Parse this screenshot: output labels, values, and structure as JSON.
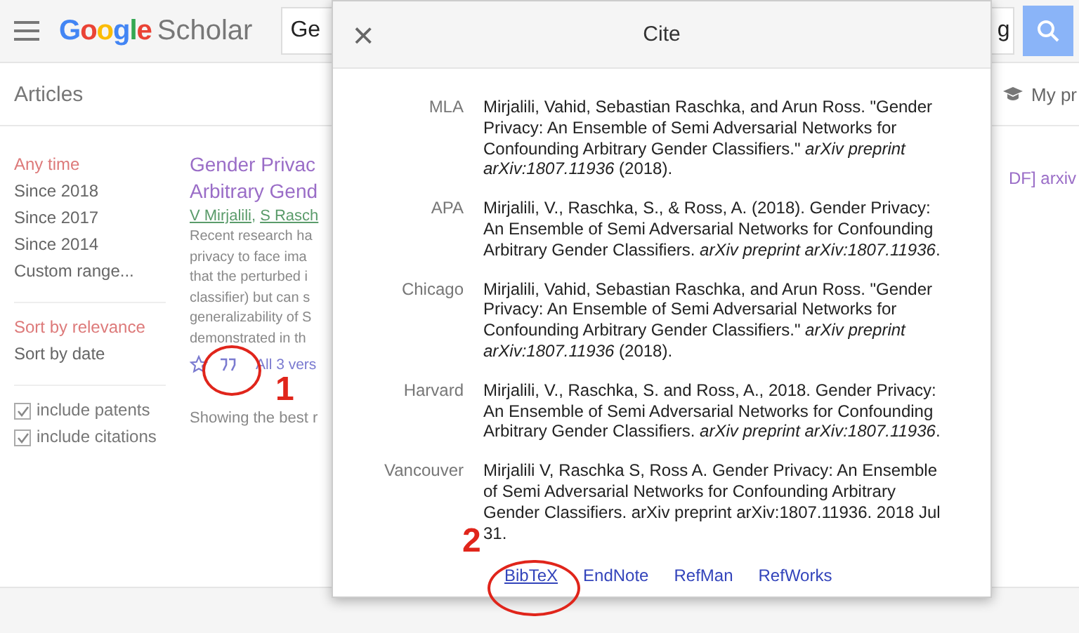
{
  "header": {
    "logo_colored": "Google",
    "logo_rest": "Scholar",
    "search_value_left": "Ge",
    "search_value_right": "g"
  },
  "subbar": {
    "title": "Articles",
    "right": "My pr"
  },
  "filters": {
    "time": [
      {
        "label": "Any time",
        "selected": true
      },
      {
        "label": "Since 2018",
        "selected": false
      },
      {
        "label": "Since 2017",
        "selected": false
      },
      {
        "label": "Since 2014",
        "selected": false
      },
      {
        "label": "Custom range...",
        "selected": false
      }
    ],
    "sort": [
      {
        "label": "Sort by relevance",
        "selected": true
      },
      {
        "label": "Sort by date",
        "selected": false
      }
    ],
    "options": [
      {
        "label": "include patents",
        "checked": true
      },
      {
        "label": "include citations",
        "checked": true
      }
    ]
  },
  "result": {
    "title_lines": [
      "Gender Privac",
      "Arbitrary Gend"
    ],
    "authors": [
      "V Mirjalili",
      "S Rasch"
    ],
    "author_separator": ",",
    "snippet": [
      "Recent research ha",
      "privacy to face ima",
      "that the perturbed i",
      "classifier) but can s",
      "generalizability of S",
      "demonstrated in th"
    ],
    "versions": "All 3 vers",
    "pdf_link": "DF] arxiv",
    "showing": "Showing the best r"
  },
  "dialog": {
    "close": "×",
    "title": "Cite",
    "citations": [
      {
        "style": "MLA",
        "text": "Mirjalili, Vahid, Sebastian Raschka, and Arun Ross. \"Gender Privacy: An Ensemble of Semi Adversarial Networks for Confounding Arbitrary Gender Classifiers.\" *arXiv preprint arXiv:1807.11936* (2018)."
      },
      {
        "style": "APA",
        "text": "Mirjalili, V., Raschka, S., & Ross, A. (2018). Gender Privacy: An Ensemble of Semi Adversarial Networks for Confounding Arbitrary Gender Classifiers. *arXiv preprint arXiv:1807.11936*."
      },
      {
        "style": "Chicago",
        "text": "Mirjalili, Vahid, Sebastian Raschka, and Arun Ross. \"Gender Privacy: An Ensemble of Semi Adversarial Networks for Confounding Arbitrary Gender Classifiers.\" *arXiv preprint arXiv:1807.11936* (2018)."
      },
      {
        "style": "Harvard",
        "text": "Mirjalili, V., Raschka, S. and Ross, A., 2018. Gender Privacy: An Ensemble of Semi Adversarial Networks for Confounding Arbitrary Gender Classifiers. *arXiv preprint arXiv:1807.11936*."
      },
      {
        "style": "Vancouver",
        "text": "Mirjalili V, Raschka S, Ross A. Gender Privacy: An Ensemble of Semi Adversarial Networks for Confounding Arbitrary Gender Classifiers. arXiv preprint arXiv:1807.11936. 2018 Jul 31."
      }
    ],
    "exports": [
      "BibTeX",
      "EndNote",
      "RefMan",
      "RefWorks"
    ]
  },
  "annotations": [
    {
      "label": "1"
    },
    {
      "label": "2"
    }
  ]
}
